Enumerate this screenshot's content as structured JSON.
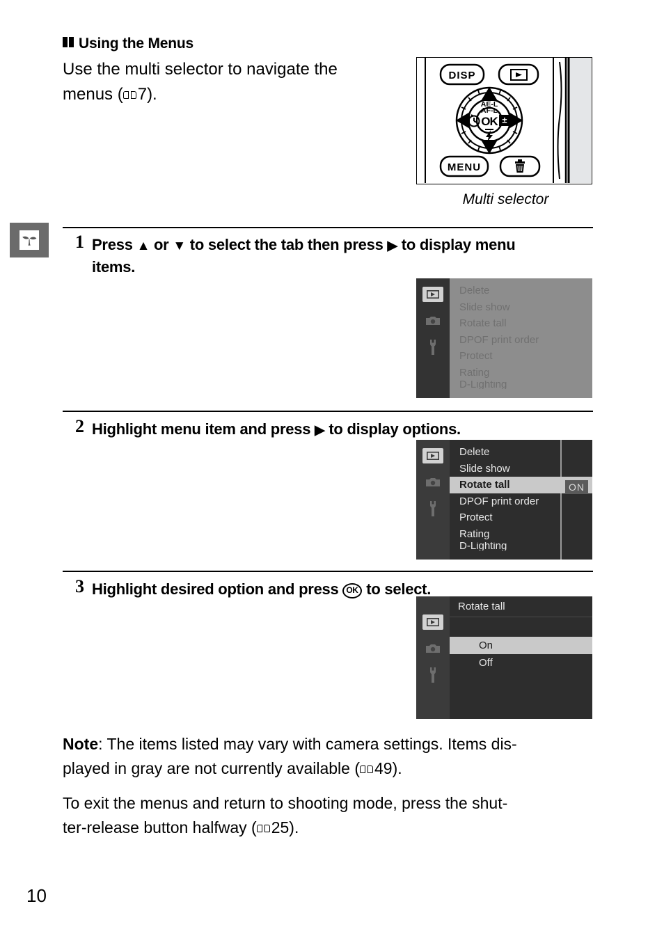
{
  "page": {
    "number": "10",
    "chapter_tab_icon": "scene-sprout-icon"
  },
  "heading": {
    "title": "Using the Menus"
  },
  "intro": {
    "line1": "Use the multi selector to navigate the",
    "line2_pre": "menus (",
    "line2_ref": "7",
    "line2_post": ")."
  },
  "figure": {
    "caption": "Multi selector",
    "buttons": {
      "disp": "DISP",
      "playback": "playback-icon",
      "menu": "MENU",
      "delete": "trash-icon",
      "ok": "OK",
      "ae_af_lock_line1": "AE-L",
      "ae_af_lock_line2": "AF-L",
      "self_timer": "self-timer-icon",
      "exposure_comp": "exposure-compensation-icon",
      "flash": "flash-icon"
    }
  },
  "steps": [
    {
      "number": "1",
      "text_line1_a": "Press ",
      "text_line1_b": " or ",
      "text_line1_c": " to select the tab then press ",
      "text_line1_d": " to display menu",
      "text_line2": "items."
    },
    {
      "number": "2",
      "text_a": "Highlight menu item and press ",
      "text_b": " to display options."
    },
    {
      "number": "3",
      "text_a": "Highlight desired option and press ",
      "text_ok": "OK",
      "text_b": " to select."
    }
  ],
  "screens": {
    "step1": {
      "tabs": [
        "playback-icon",
        "camera-icon",
        "wrench-icon"
      ],
      "selected_tab_index": 0,
      "items": [
        "Delete",
        "Slide show",
        "Rotate tall",
        "DPOF print order",
        "Protect",
        "Rating",
        "D-Lighting"
      ],
      "state": "inactive-gray"
    },
    "step2": {
      "tabs": [
        "playback-icon",
        "camera-icon",
        "wrench-icon"
      ],
      "selected_tab_index": 0,
      "items": [
        "Delete",
        "Slide show",
        "Rotate tall",
        "DPOF print order",
        "Protect",
        "Rating",
        "D-Lighting"
      ],
      "highlighted_item": "Rotate tall",
      "highlighted_value": "ON",
      "state": "active"
    },
    "step3": {
      "tabs": [
        "playback-icon",
        "camera-icon",
        "wrench-icon"
      ],
      "selected_tab_index": 0,
      "title": "Rotate tall",
      "options": [
        "On",
        "Off"
      ],
      "highlighted_option": "On",
      "state": "options"
    }
  },
  "notes": {
    "note1_label": "Note",
    "note1_a": ": The items listed may vary with camera settings.  Items dis-",
    "note1_b": "played in gray are not currently available (",
    "note1_ref": "49",
    "note1_c": ").",
    "note2_a": "To exit the menus and return to shooting mode, press the shut-",
    "note2_b": "ter-release button halfway (",
    "note2_ref": "25",
    "note2_c": ")."
  },
  "colors": {
    "lcd_tab_bar": "#3b3b3b",
    "lcd_active_bg": "#2d2d2d",
    "lcd_inactive_bg": "#8d8d8d",
    "lcd_highlight": "#c9c9c9",
    "chapter_tab": "#6b6b6b"
  }
}
